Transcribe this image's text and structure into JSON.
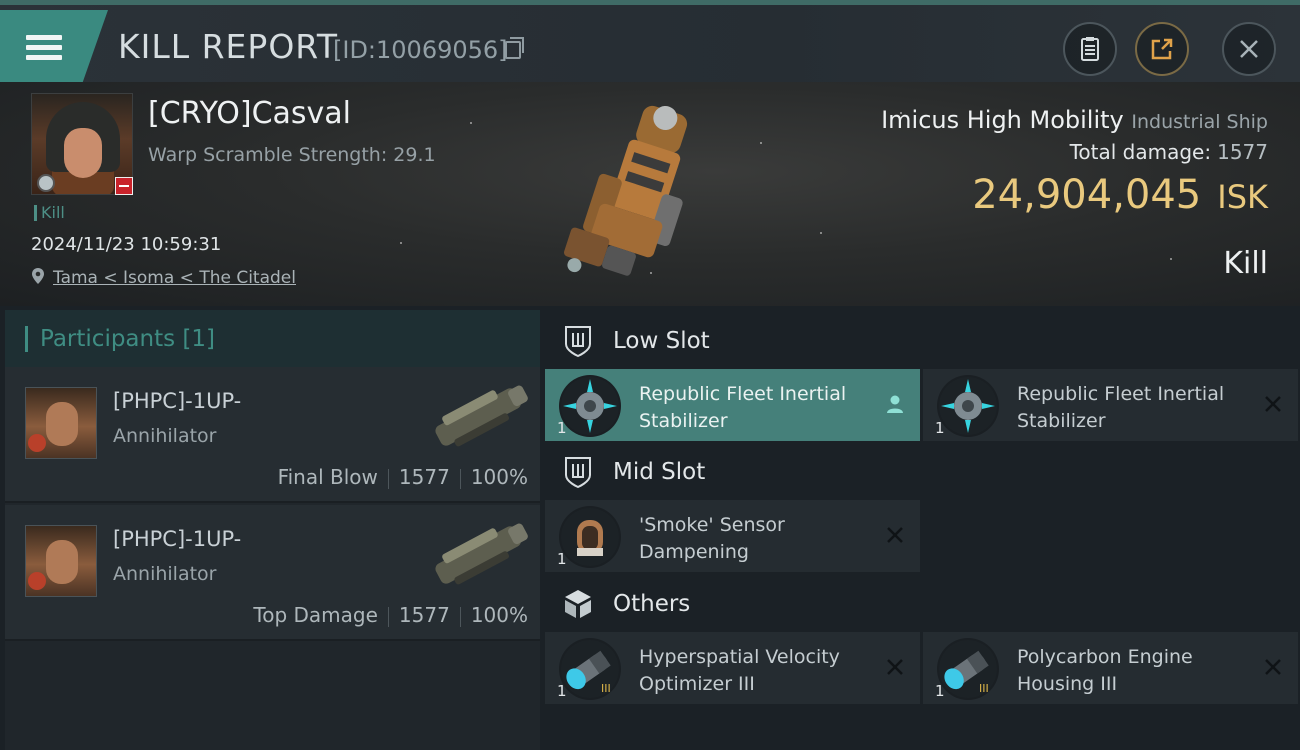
{
  "topbar": {
    "title": "KILL REPORT",
    "report_id": "[ID:10069056]",
    "icons": [
      "menu-icon",
      "copy-icon",
      "clipboard-icon",
      "share-icon",
      "close-icon"
    ]
  },
  "victim": {
    "name": "[CRYO]Casval",
    "warp_scramble": "Warp Scramble Strength: 29.1",
    "kill_tag": "Kill",
    "datetime": "2024/11/23 10:59:31",
    "location": "Tama < Isoma < The Citadel"
  },
  "ship": {
    "name": "Imicus High Mobility",
    "class": "Industrial Ship",
    "total_damage_label": "Total damage:",
    "total_damage_value": "1577",
    "isk_value": "24,904,045",
    "isk_unit": "ISK",
    "result": "Kill"
  },
  "participants": {
    "header": "Participants [1]",
    "rows": [
      {
        "name": "[PHPC]-1UP-",
        "ship": "Annihilator",
        "role": "Final Blow",
        "damage": "1577",
        "percent": "100%"
      },
      {
        "name": "[PHPC]-1UP-",
        "ship": "Annihilator",
        "role": "Top Damage",
        "damage": "1577",
        "percent": "100%"
      }
    ]
  },
  "slots": {
    "low": {
      "label": "Low Slot",
      "items": [
        {
          "name": "Republic Fleet Inertial Stabilizer",
          "qty": "1",
          "status": "person-icon"
        },
        {
          "name": "Republic Fleet Inertial Stabilizer",
          "qty": "1",
          "status": "x-icon"
        }
      ]
    },
    "mid": {
      "label": "Mid Slot",
      "items": [
        {
          "name": "'Smoke' Sensor Dampening",
          "qty": "1",
          "status": "x-icon"
        }
      ]
    },
    "others": {
      "label": "Others",
      "items": [
        {
          "name": "Hyperspatial Velocity Optimizer III",
          "qty": "1",
          "status": "x-icon"
        },
        {
          "name": "Polycarbon Engine Housing III",
          "qty": "1",
          "status": "x-icon"
        }
      ]
    }
  },
  "colors": {
    "accent": "#3f8d83",
    "isk": "#e9c97e",
    "danger": "#c9232b"
  }
}
